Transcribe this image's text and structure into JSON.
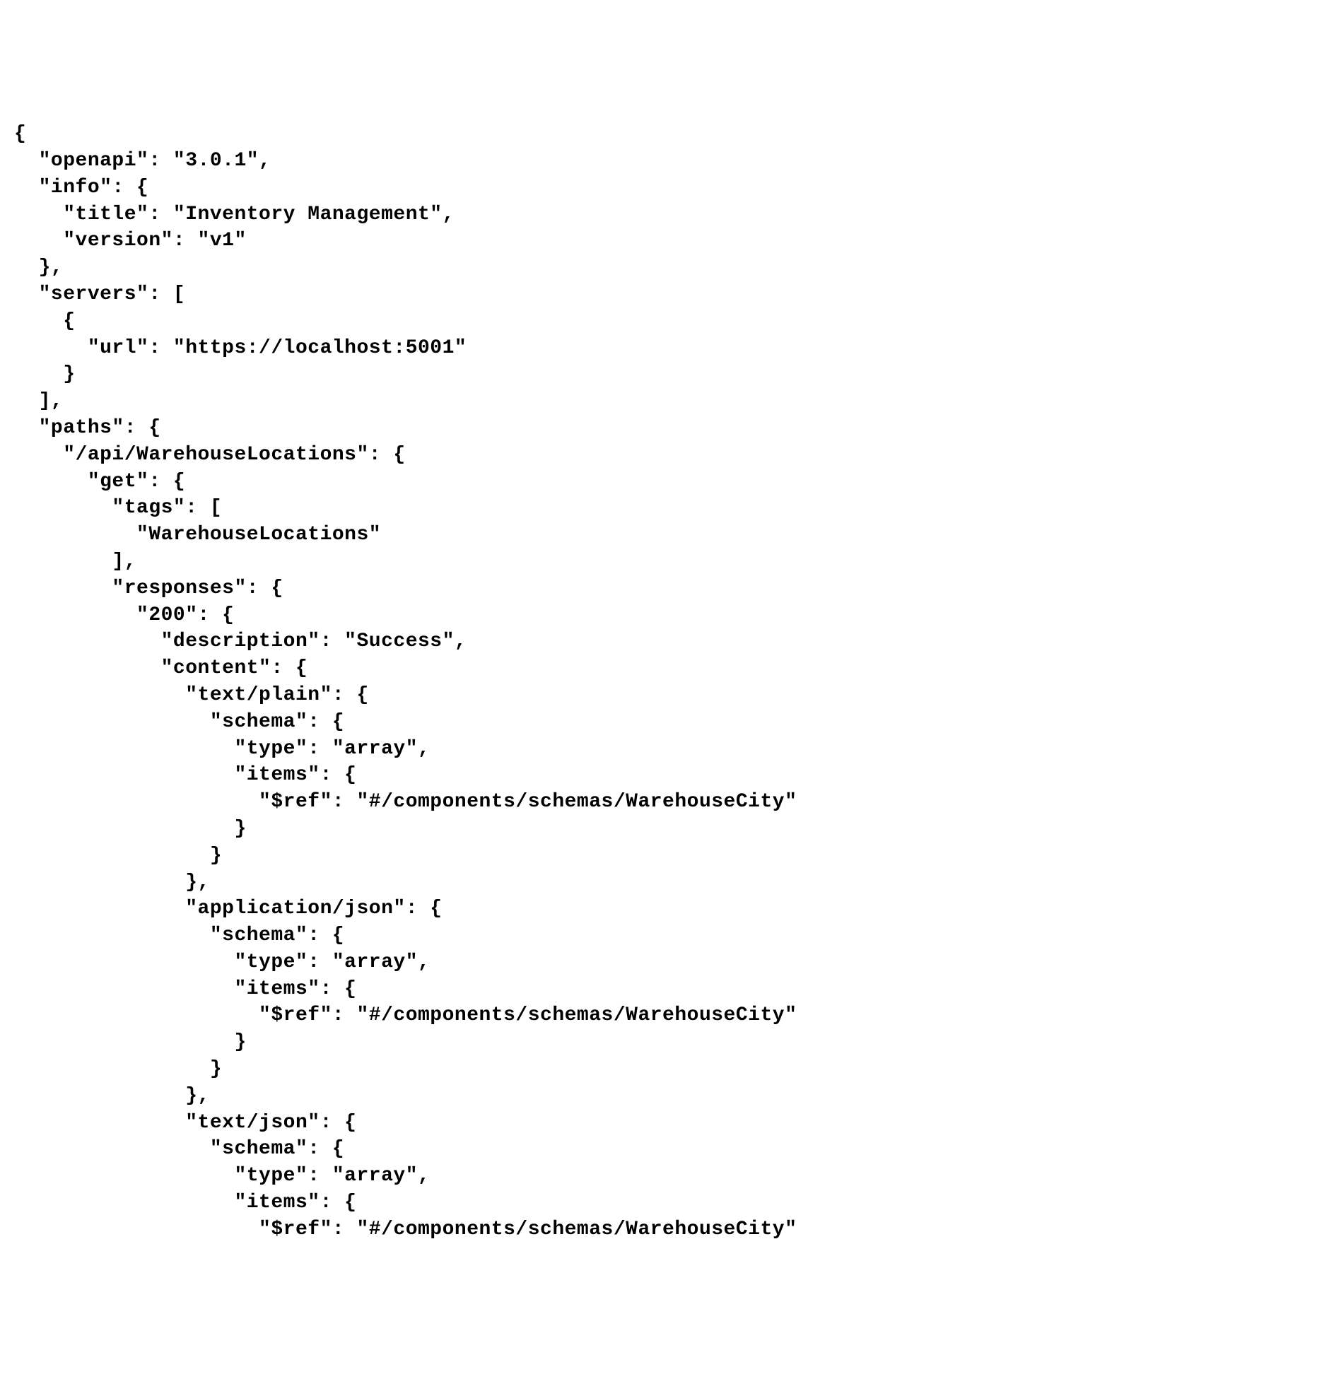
{
  "code": {
    "lines": [
      "{",
      "  \"openapi\": \"3.0.1\",",
      "  \"info\": {",
      "    \"title\": \"Inventory Management\",",
      "    \"version\": \"v1\"",
      "  },",
      "  \"servers\": [",
      "    {",
      "      \"url\": \"https://localhost:5001\"",
      "    }",
      "  ],",
      "  \"paths\": {",
      "    \"/api/WarehouseLocations\": {",
      "      \"get\": {",
      "        \"tags\": [",
      "          \"WarehouseLocations\"",
      "        ],",
      "        \"responses\": {",
      "          \"200\": {",
      "            \"description\": \"Success\",",
      "            \"content\": {",
      "              \"text/plain\": {",
      "                \"schema\": {",
      "                  \"type\": \"array\",",
      "                  \"items\": {",
      "                    \"$ref\": \"#/components/schemas/WarehouseCity\"",
      "                  }",
      "                }",
      "              },",
      "              \"application/json\": {",
      "                \"schema\": {",
      "                  \"type\": \"array\",",
      "                  \"items\": {",
      "                    \"$ref\": \"#/components/schemas/WarehouseCity\"",
      "                  }",
      "                }",
      "              },",
      "              \"text/json\": {",
      "                \"schema\": {",
      "                  \"type\": \"array\",",
      "                  \"items\": {",
      "                    \"$ref\": \"#/components/schemas/WarehouseCity\""
    ]
  }
}
